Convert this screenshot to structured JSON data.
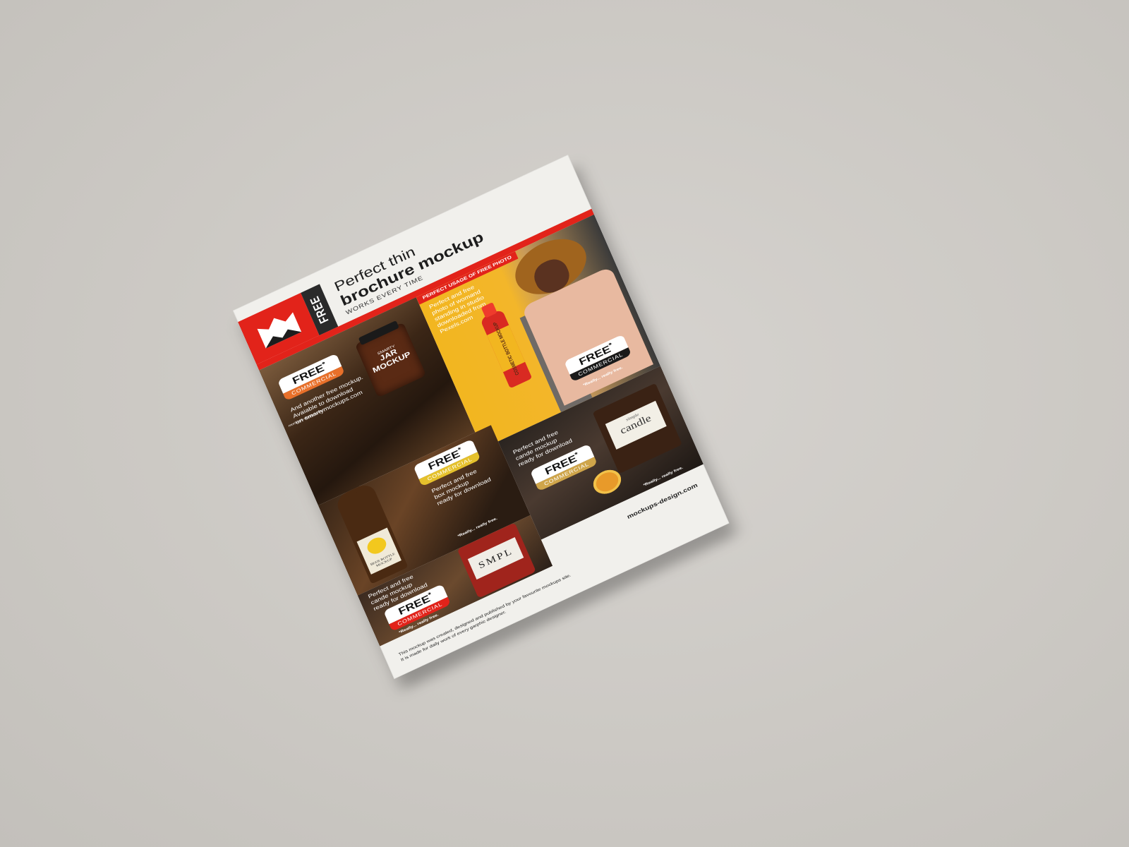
{
  "header": {
    "title_line1": "Perfect thin",
    "title_line2": "brochure mockup",
    "subtitle": "WORKS EVERY TIME",
    "free_tab": "FREE",
    "logo_url": "mockups-design.com"
  },
  "panels": {
    "jar": {
      "product_small": "SMARTY",
      "product_big": "JAR MOCKUP",
      "badge_top": "FREE",
      "badge_star": "*",
      "badge_bottom": "COMMERCIAL",
      "text_line1": "And another free mockup.",
      "text_line2": "Avaiable to download",
      "text_line3": "on smartymockups.com"
    },
    "woman": {
      "tag": "PERFECT USAGE OF FREE PHOTO",
      "text_line1": "Perfect and free",
      "text_line2": "photo of womand",
      "text_line3": "standing in studio",
      "text_line4": "downloaded from",
      "text_line5": "Pexels.com",
      "bottle_label": "COSMETIC BOTTLE MOCKUP",
      "badge_top": "FREE",
      "badge_star": "*",
      "badge_bottom": "COMMERCIAL",
      "note": "*Really... really free."
    },
    "beer": {
      "label": "BEER BOTTLE MOCKUP",
      "badge_top": "FREE",
      "badge_star": "*",
      "badge_bottom": "COMMERCIAL",
      "text_line1": "Perfect and free",
      "text_line2": "box mockup",
      "text_line3": "ready for download",
      "note": "*Really... really free."
    },
    "candle": {
      "label_small": "simple",
      "label_big": "candle",
      "badge_top": "FREE",
      "badge_star": "*",
      "badge_bottom": "COMMERCIAL",
      "text_line1": "Perfect and free",
      "text_line2": "cande mockup",
      "text_line3": "ready for download",
      "note": "*Really... really free."
    },
    "smpl": {
      "label": "SMPL",
      "badge_top": "FREE",
      "badge_star": "*",
      "badge_bottom": "COMMERCIAL",
      "text_line1": "Perfect and free",
      "text_line2": "cande mockup",
      "text_line3": "ready for download",
      "note": "*Really... really free."
    }
  },
  "footer": {
    "site": "mockups-design.com",
    "line1": "This mockup was created, designed and published  by your favourite mockups site.",
    "line2": "It is made for daily work of every garphic designer."
  },
  "colors": {
    "brand_red": "#e2231a",
    "background": "#cdcac5",
    "paper": "#f1f0ec",
    "yellow": "#f2b620"
  }
}
